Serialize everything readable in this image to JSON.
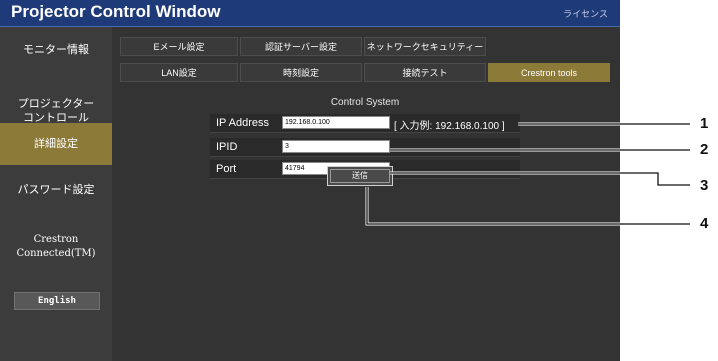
{
  "window": {
    "title": "Projector Control Window",
    "license_link": "ライセンス"
  },
  "sidebar": {
    "items": [
      {
        "label": "モニター情報"
      },
      {
        "label": "プロジェクター\nコントロール"
      },
      {
        "label": "詳細設定",
        "active": true
      },
      {
        "label": "パスワード設定"
      },
      {
        "label": "Crestron\nConnected(TM)"
      }
    ],
    "language_button": "English"
  },
  "tabs": [
    {
      "label": "Eメール設定"
    },
    {
      "label": "認証サーバー設定"
    },
    {
      "label": "ネットワークセキュリティー"
    },
    {
      "label": "LAN設定"
    },
    {
      "label": "時刻設定"
    },
    {
      "label": "接続テスト"
    },
    {
      "label": "Crestron tools",
      "active": true
    }
  ],
  "control_system": {
    "title": "Control System",
    "fields": [
      {
        "label": "IP Address",
        "value": "192.168.0.100",
        "hint": "[ 入力例: 192.168.0.100 ]"
      },
      {
        "label": "IPID",
        "value": "3"
      },
      {
        "label": "Port",
        "value": "41794"
      }
    ],
    "submit_label": "送信"
  },
  "callouts": [
    "1",
    "2",
    "3",
    "4"
  ],
  "colors": {
    "title_bar": "#1e3a78",
    "active": "#8c7b38",
    "background": "#333333"
  }
}
